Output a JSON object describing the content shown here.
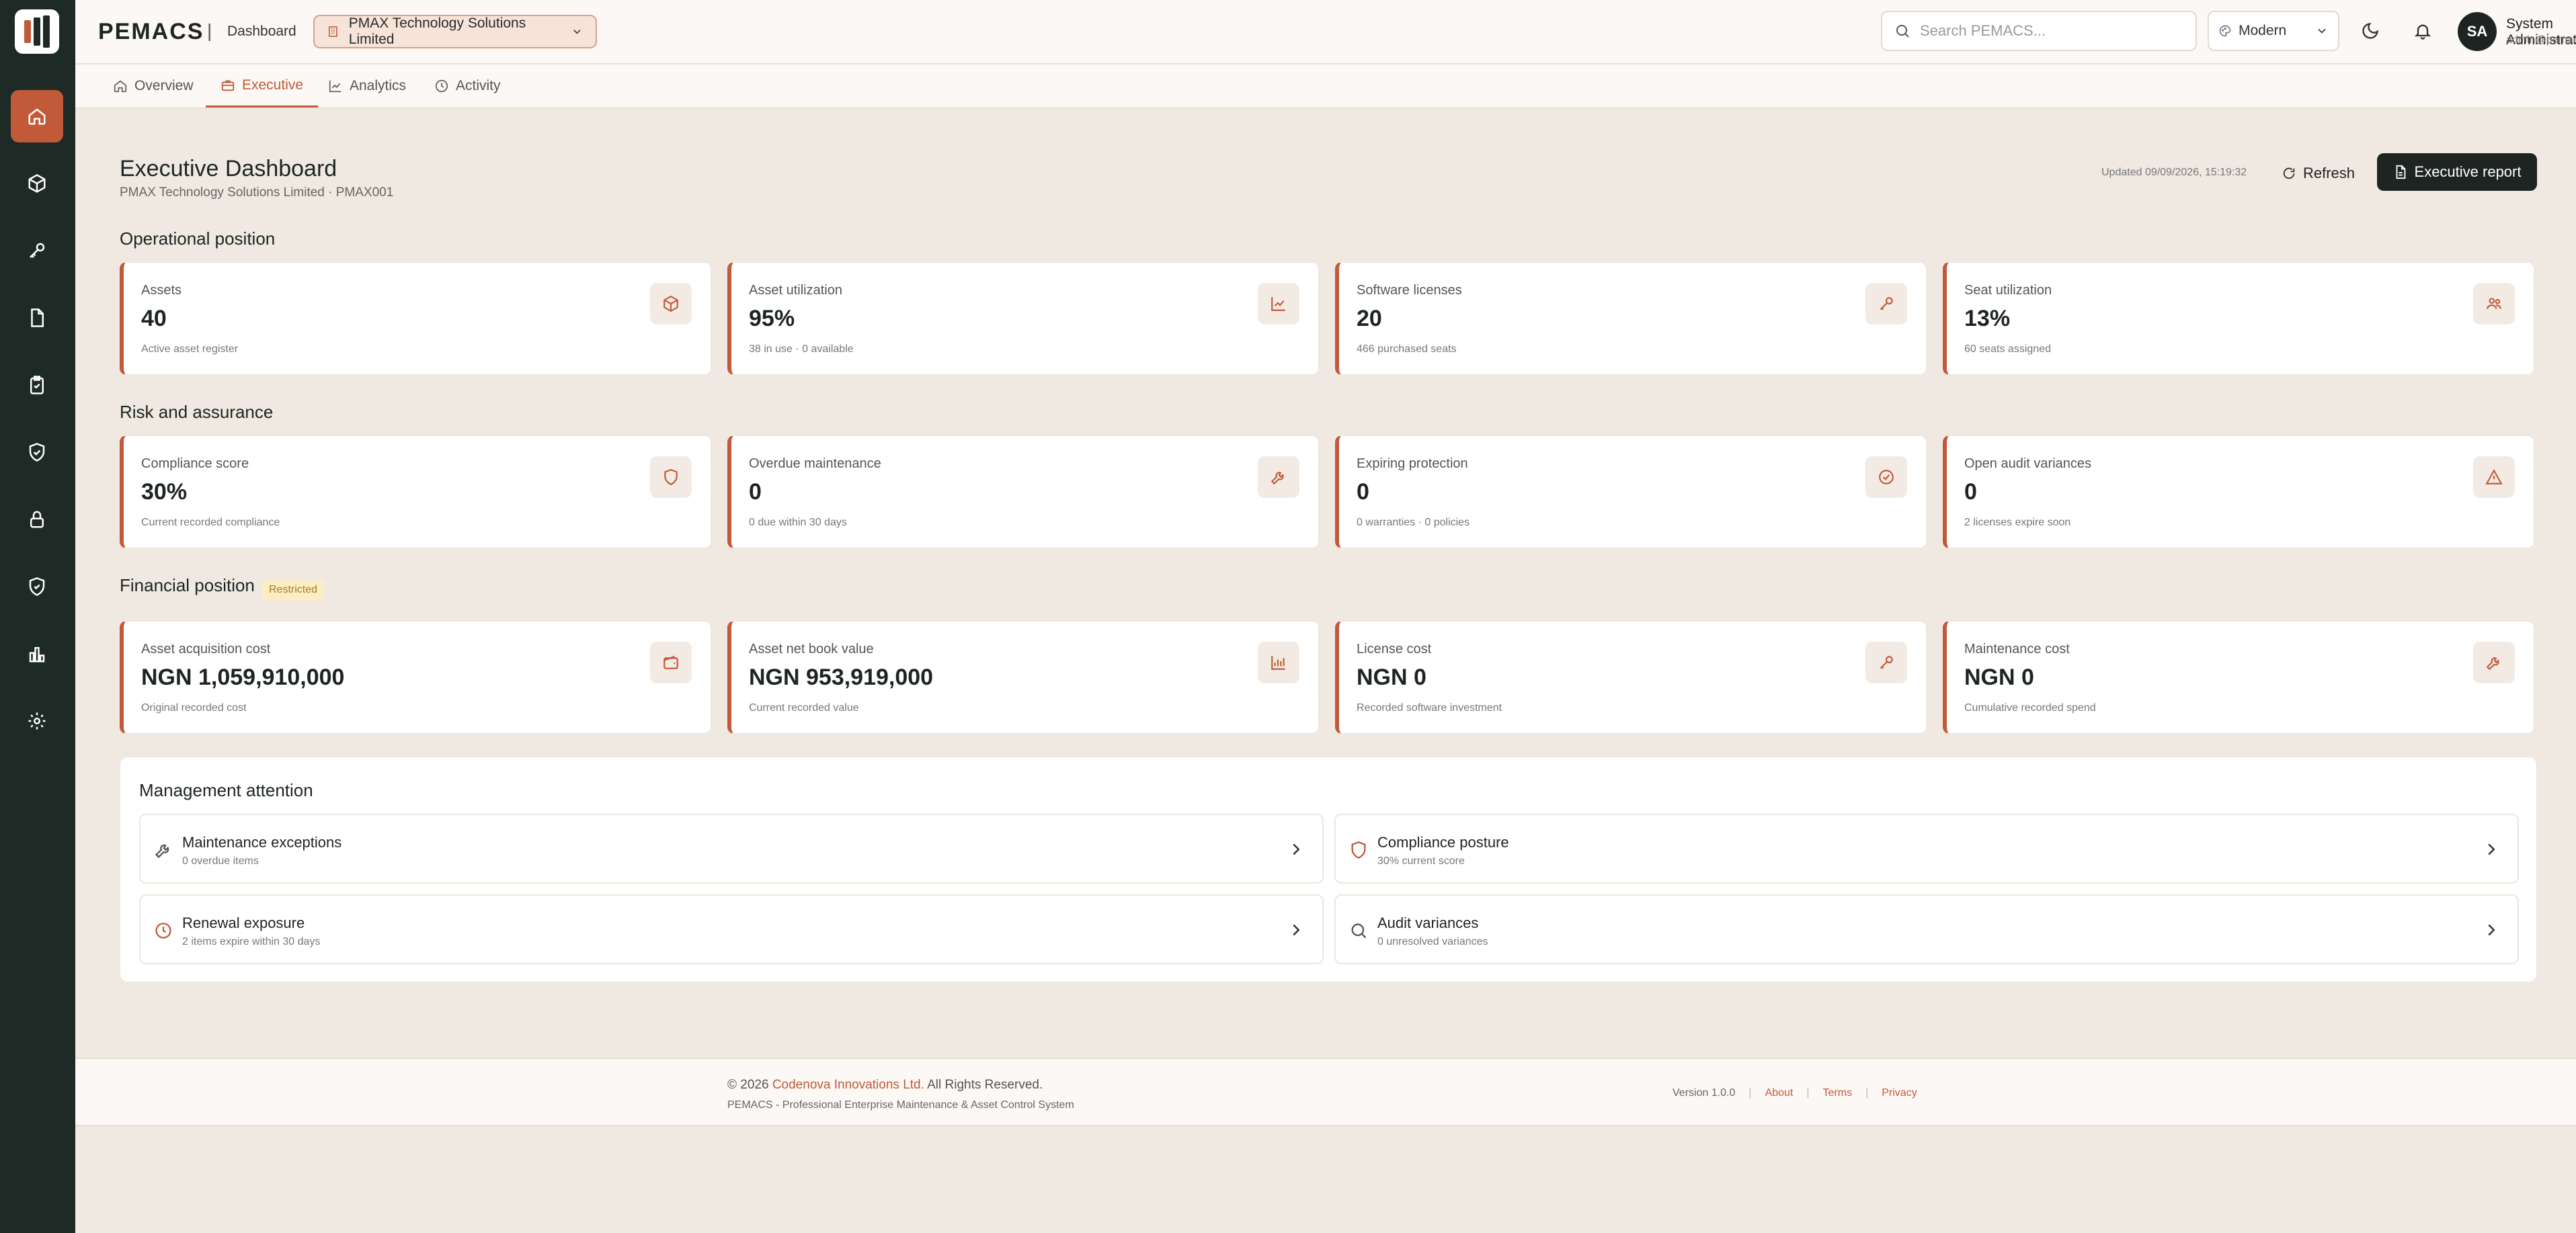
{
  "app": {
    "brand": "PEMACS",
    "crumb": "Dashboard"
  },
  "org_select": {
    "value": "PMAX Technology Solutions Limited"
  },
  "search": {
    "placeholder": "Search PEMACS..."
  },
  "theme_select": {
    "value": "Modern"
  },
  "user": {
    "initials": "SA",
    "name": "System Administrator",
    "email": "admin@pemacs.com"
  },
  "tabs": [
    {
      "label": "Overview",
      "icon": "home-icon"
    },
    {
      "label": "Executive",
      "icon": "briefcase-icon",
      "active": true
    },
    {
      "label": "Analytics",
      "icon": "line-chart-icon"
    },
    {
      "label": "Activity",
      "icon": "clock-icon"
    }
  ],
  "sidebar": {
    "items": [
      {
        "icon": "home-icon",
        "active": true
      },
      {
        "icon": "box-icon"
      },
      {
        "icon": "key-icon"
      },
      {
        "icon": "document-icon"
      },
      {
        "icon": "clipboard-check-icon"
      },
      {
        "icon": "shield-check-icon"
      },
      {
        "icon": "lock-icon"
      },
      {
        "icon": "shield-icon"
      },
      {
        "icon": "bar-chart-icon"
      },
      {
        "icon": "gear-icon"
      }
    ]
  },
  "header": {
    "title": "Executive Dashboard",
    "subtitle": "PMAX Technology Solutions Limited · PMAX001",
    "updated": "Updated 09/09/2026, 15:19:32",
    "refresh_label": "Refresh",
    "report_label": "Executive report"
  },
  "sections": {
    "operational": "Operational position",
    "risk": "Risk and assurance",
    "financial": "Financial position",
    "financial_badge": "Restricted"
  },
  "operational_cards": [
    {
      "label": "Assets",
      "value": "40",
      "hint": "Active asset register",
      "icon": "box-icon"
    },
    {
      "label": "Asset utilization",
      "value": "95%",
      "hint": "38 in use · 0 available",
      "icon": "trend-icon"
    },
    {
      "label": "Software licenses",
      "value": "20",
      "hint": "466 purchased seats",
      "icon": "key-icon"
    },
    {
      "label": "Seat utilization",
      "value": "13%",
      "hint": "60 seats assigned",
      "icon": "users-icon"
    }
  ],
  "risk_cards": [
    {
      "label": "Compliance score",
      "value": "30%",
      "hint": "Current recorded compliance",
      "icon": "shield-icon"
    },
    {
      "label": "Overdue maintenance",
      "value": "0",
      "hint": "0 due within 30 days",
      "icon": "wrench-icon"
    },
    {
      "label": "Expiring protection",
      "value": "0",
      "hint": "0 warranties · 0 policies",
      "icon": "check-circle-icon"
    },
    {
      "label": "Open audit variances",
      "value": "0",
      "hint": "2 licenses expire soon",
      "icon": "warning-icon"
    }
  ],
  "financial_cards": [
    {
      "label": "Asset acquisition cost",
      "value": "NGN 1,059,910,000",
      "hint": "Original recorded cost",
      "icon": "wallet-icon"
    },
    {
      "label": "Asset net book value",
      "value": "NGN 953,919,000",
      "hint": "Current recorded value",
      "icon": "bar-chart-icon"
    },
    {
      "label": "License cost",
      "value": "NGN 0",
      "hint": "Recorded software investment",
      "icon": "key-icon"
    },
    {
      "label": "Maintenance cost",
      "value": "NGN 0",
      "hint": "Cumulative recorded spend",
      "icon": "wrench-icon"
    }
  ],
  "attention": {
    "title": "Management attention",
    "items": [
      {
        "title": "Maintenance exceptions",
        "sub": "0 overdue items",
        "icon": "wrench-icon"
      },
      {
        "title": "Compliance posture",
        "sub": "30% current score",
        "icon": "shield-icon"
      },
      {
        "title": "Renewal exposure",
        "sub": "2 items expire within 30 days",
        "icon": "clock-icon"
      },
      {
        "title": "Audit variances",
        "sub": "0 unresolved variances",
        "icon": "search-icon"
      }
    ]
  },
  "footer": {
    "copy_prefix": "© 2026",
    "copy_brand": "Codenova Innovations Ltd.",
    "copy_suffix": "All Rights Reserved.",
    "tagline": "PEMACS - Professional Enterprise Maintenance & Asset Control System",
    "version": "Version 1.0.0",
    "about": "About",
    "terms": "Terms",
    "privacy": "Privacy"
  },
  "colors": {
    "accent": "#c25a3a",
    "sidebar": "#1d2a26",
    "background": "#efe9e1"
  }
}
